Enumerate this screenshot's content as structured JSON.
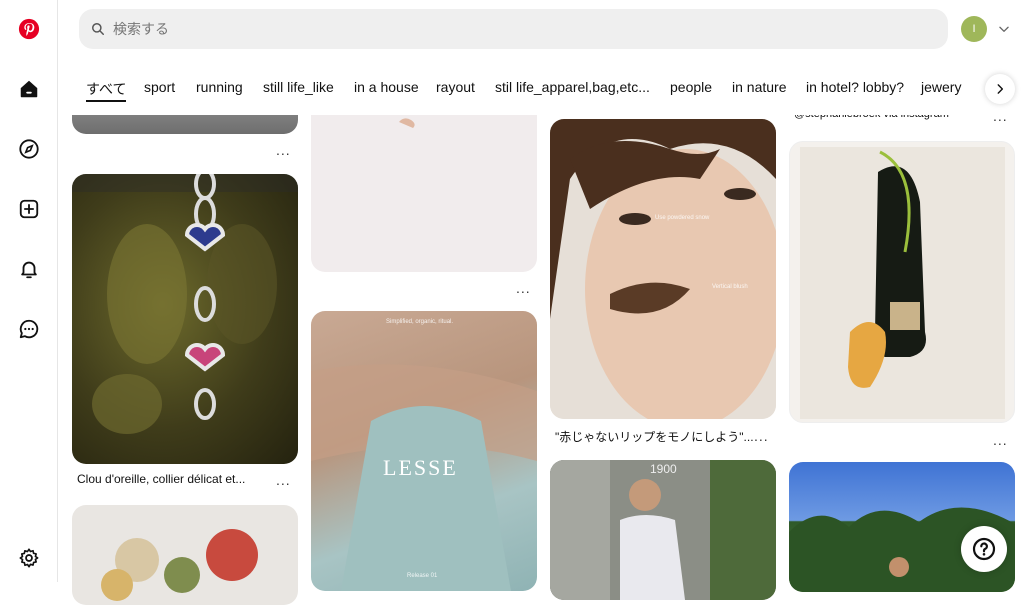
{
  "search": {
    "placeholder": "検索する"
  },
  "account": {
    "initial": "I"
  },
  "tabs": [
    {
      "label": "すべて"
    },
    {
      "label": "sport"
    },
    {
      "label": "running"
    },
    {
      "label": "still life_like"
    },
    {
      "label": "in a house"
    },
    {
      "label": "rayout"
    },
    {
      "label": "stil life_apparel,bag,etc..."
    },
    {
      "label": "people"
    },
    {
      "label": "in nature"
    },
    {
      "label": "in hotel? lobby?"
    },
    {
      "label": "jewery"
    }
  ],
  "pins": {
    "col4_top_caption": "@stephaniebroek via instagram",
    "jar_caption": "Clou d'oreille, collier délicat et...",
    "face_caption": "\"赤じゃないリップをモノにしよう\"...",
    "face_overlay_1": "Use powdered snow",
    "face_overlay_2": "Vertical blush",
    "lesse_title": "LESSE",
    "lesse_sub_top": "Simplified, organic, ritual.",
    "lesse_sub_bottom": "Release 01",
    "runner_sign": "1900",
    "more_label": "..."
  },
  "colors": {
    "brand": "#e60023",
    "avatar": "#9fb75a"
  }
}
